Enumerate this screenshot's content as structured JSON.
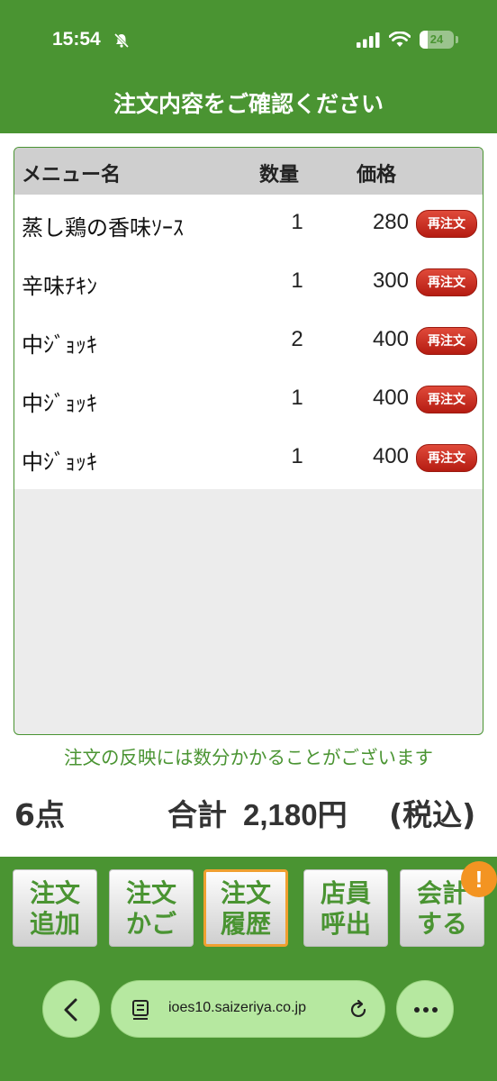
{
  "status_bar": {
    "time": "15:54",
    "battery": "24",
    "icons": [
      "bell-slash-icon",
      "signal-icon",
      "wifi-icon",
      "battery-icon"
    ]
  },
  "header": {
    "title": "注文内容をご確認ください"
  },
  "table": {
    "columns": [
      "メニュー名",
      "数量",
      "価格"
    ],
    "reorder_label": "再注文",
    "rows": [
      {
        "name": "蒸し鶏の香味ｿｰｽ",
        "qty": "1",
        "price": "280"
      },
      {
        "name": "辛味ﾁｷﾝ",
        "qty": "1",
        "price": "300"
      },
      {
        "name": "中ｼﾞｮｯｷ",
        "qty": "2",
        "price": "400"
      },
      {
        "name": "中ｼﾞｮｯｷ",
        "qty": "1",
        "price": "400"
      },
      {
        "name": "中ｼﾞｮｯｷ",
        "qty": "1",
        "price": "400"
      }
    ]
  },
  "notice": "注文の反映には数分かかることがございます",
  "summary": {
    "count": "6点",
    "total_label": "合計",
    "total_value": "2,180円",
    "tax_note": "(税込)"
  },
  "bottom_nav": [
    {
      "line1": "注文",
      "line2": "追加",
      "active": false
    },
    {
      "line1": "注文",
      "line2": "かご",
      "active": false
    },
    {
      "line1": "注文",
      "line2": "履歴",
      "active": true
    },
    {
      "line1": "店員",
      "line2": "呼出",
      "active": false
    },
    {
      "line1": "会計",
      "line2": "する",
      "active": false
    }
  ],
  "alert_badge": "!",
  "browser": {
    "url": "ioes10.saizeriya.co.jp",
    "icons": [
      "back-icon",
      "page-icon",
      "reload-icon",
      "more-icon"
    ]
  },
  "colors": {
    "brand_green": "#4a9432",
    "reorder_red": "#c0281c",
    "active_border": "#f0a030",
    "alert_orange": "#f39422"
  }
}
